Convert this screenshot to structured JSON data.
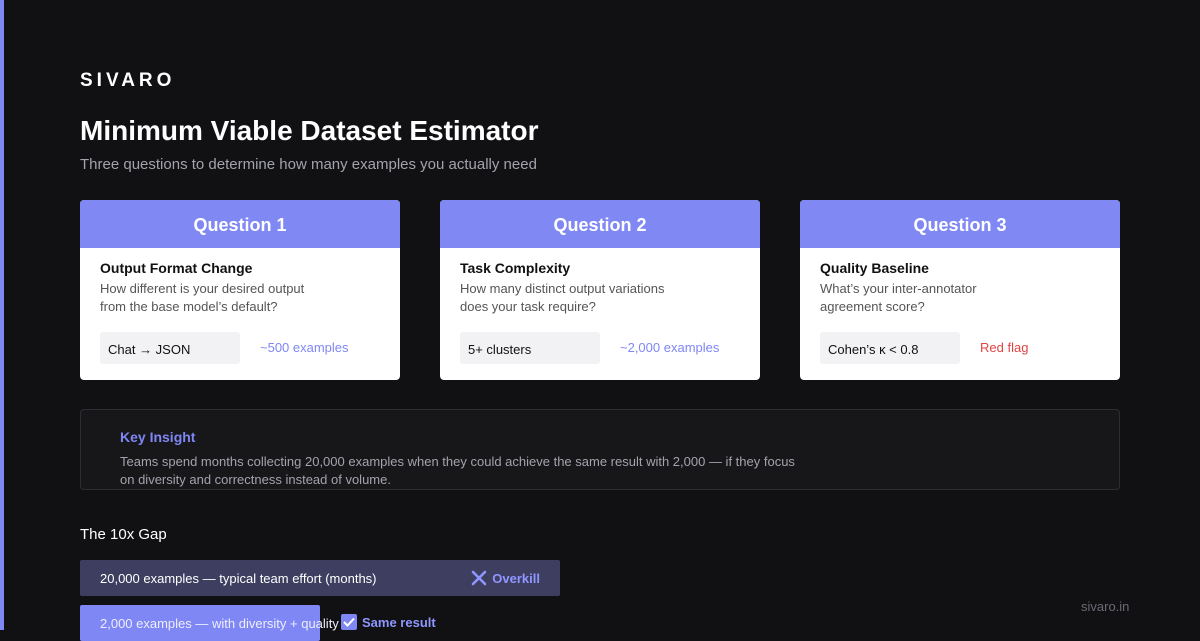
{
  "brand": "SIVARO",
  "title": "Minimum Viable Dataset Estimator",
  "subtitle": "Three questions to determine how many examples you actually need",
  "cards": [
    {
      "header": "Question 1",
      "label": "Output Format Change",
      "question": "How different is your desired output from the base model’s default?",
      "chip": "Chat → JSON",
      "estimate": "~500 examples"
    },
    {
      "header": "Question 2",
      "label": "Task Complexity",
      "question": "How many distinct output variations does your task require?",
      "chip": "5+ clusters",
      "estimate": "~2,000 examples"
    },
    {
      "header": "Question 3",
      "label": "Quality Baseline",
      "question": "What’s your inter-annotator agreement score?",
      "chip": "Cohen’s κ < 0.8",
      "estimate": "Red flag"
    }
  ],
  "insight": {
    "title": "Key Insight",
    "text": "Teams spend months collecting 20,000 examples when they could achieve the same result with 2,000 — if they focus on diversity and correctness instead of volume."
  },
  "gap": {
    "title": "The 10x Gap",
    "bar1_text": "20,000 examples — typical team effort (months)",
    "bar1_tag": "Overkill",
    "bar2_text": "2,000 examples — with diversity + quality",
    "bar2_tag": "Same result"
  },
  "footer": "sivaro.in",
  "colors": {
    "accent": "#7f87f5",
    "background": "#111113",
    "red_flag": "#e04545"
  }
}
